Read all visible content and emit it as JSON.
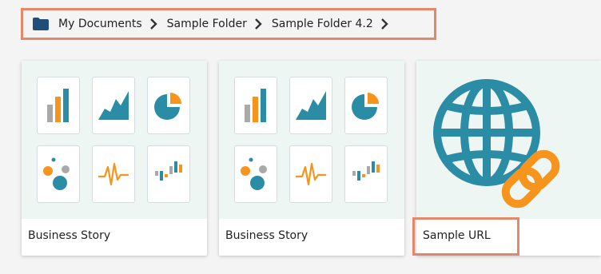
{
  "breadcrumb": {
    "items": [
      "My Documents",
      "Sample Folder",
      "Sample Folder 4.2"
    ],
    "icon": "folder-icon"
  },
  "cards": [
    {
      "title": "Business Story",
      "type": "story",
      "icons": [
        "bar-chart-icon",
        "area-chart-icon",
        "pie-chart-icon",
        "bubble-chart-icon",
        "waveform-icon",
        "waterfall-chart-icon"
      ]
    },
    {
      "title": "Business Story",
      "type": "story",
      "icons": [
        "bar-chart-icon",
        "area-chart-icon",
        "pie-chart-icon",
        "bubble-chart-icon",
        "waveform-icon",
        "waterfall-chart-icon"
      ]
    },
    {
      "title": "Sample URL",
      "type": "url",
      "icons": [
        "globe-link-icon"
      ]
    }
  ],
  "colors": {
    "highlight": "#e5876b",
    "teal": "#2a8ca5",
    "orange": "#f7941d",
    "gray": "#a9a9a9",
    "folder": "#1f4e79"
  }
}
